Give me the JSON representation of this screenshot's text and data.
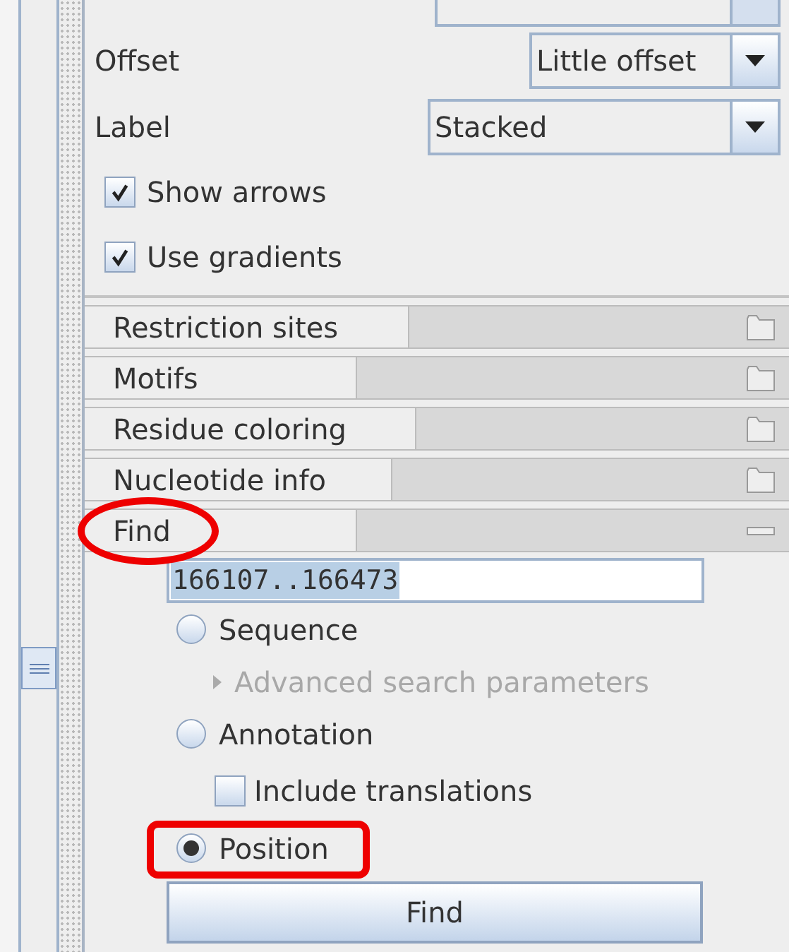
{
  "settings": [
    {
      "kind": "dropdown",
      "label": "Offset",
      "value": "Little offset"
    },
    {
      "kind": "dropdown",
      "label": "Label",
      "value": "Stacked"
    },
    {
      "kind": "checkbox",
      "label": "Show arrows",
      "checked": true
    },
    {
      "kind": "checkbox",
      "label": "Use gradients",
      "checked": true
    }
  ],
  "sections": [
    {
      "title": "Restriction sites",
      "expanded": false,
      "circled": false
    },
    {
      "title": "Motifs",
      "expanded": false,
      "circled": false
    },
    {
      "title": "Residue coloring",
      "expanded": false,
      "circled": false
    },
    {
      "title": "Nucleotide info",
      "expanded": false,
      "circled": false
    },
    {
      "title": "Find",
      "expanded": true,
      "circled": true
    }
  ],
  "find": {
    "query": "166107..166473",
    "options": [
      {
        "kind": "radio",
        "label": "Sequence",
        "selected": false,
        "boxed": false
      },
      {
        "kind": "disclosure",
        "label": "Advanced search parameters",
        "disabled": true
      },
      {
        "kind": "radio",
        "label": "Annotation",
        "selected": false,
        "boxed": false
      },
      {
        "kind": "checkbox",
        "label": "Include translations",
        "checked": false
      },
      {
        "kind": "radio",
        "label": "Position",
        "selected": true,
        "boxed": true
      }
    ],
    "button": "Find"
  }
}
